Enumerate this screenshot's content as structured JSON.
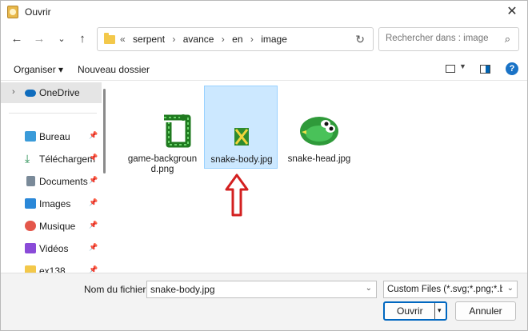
{
  "window": {
    "title": "Ouvrir"
  },
  "address": {
    "overflow": "«",
    "crumbs": [
      "serpent",
      "avance",
      "en",
      "image"
    ],
    "separator": "›"
  },
  "search": {
    "placeholder": "Rechercher dans : image"
  },
  "commands": {
    "organize": "Organiser ▾",
    "new_folder": "Nouveau dossier"
  },
  "sidebar": {
    "items": [
      {
        "label": "OneDrive",
        "icon": "cloud-icon",
        "color": "#0f6cbd"
      },
      {
        "label": "Bureau",
        "icon": "desktop-icon",
        "color": "#3a9bd9"
      },
      {
        "label": "Téléchargem",
        "icon": "download-icon",
        "color": "#1f8a4c"
      },
      {
        "label": "Documents",
        "icon": "documents-icon",
        "color": "#7a8a99"
      },
      {
        "label": "Images",
        "icon": "images-icon",
        "color": "#2b88d8"
      },
      {
        "label": "Musique",
        "icon": "music-icon",
        "color": "#e4574b"
      },
      {
        "label": "Vidéos",
        "icon": "videos-icon",
        "color": "#8a4bd8"
      },
      {
        "label": "ex138",
        "icon": "folder-icon",
        "color": "#f3c84a"
      }
    ]
  },
  "files": [
    {
      "name": "game-background.png",
      "name_lines": [
        "game-backgroun",
        "d.png"
      ],
      "selected": false
    },
    {
      "name": "snake-body.jpg",
      "name_lines": [
        "snake-body.jpg"
      ],
      "selected": true
    },
    {
      "name": "snake-head.jpg",
      "name_lines": [
        "snake-head.jpg"
      ],
      "selected": false
    }
  ],
  "footer": {
    "filename_label": "Nom du fichier :",
    "filename_value": "snake-body.jpg",
    "filter": "Custom Files (*.svg;*.png;*.bmp;",
    "open_label": "Ouvrir",
    "cancel_label": "Annuler"
  },
  "colors": {
    "accent": "#0067c0",
    "selection": "#cce8ff",
    "annotation_arrow": "#d32020"
  }
}
